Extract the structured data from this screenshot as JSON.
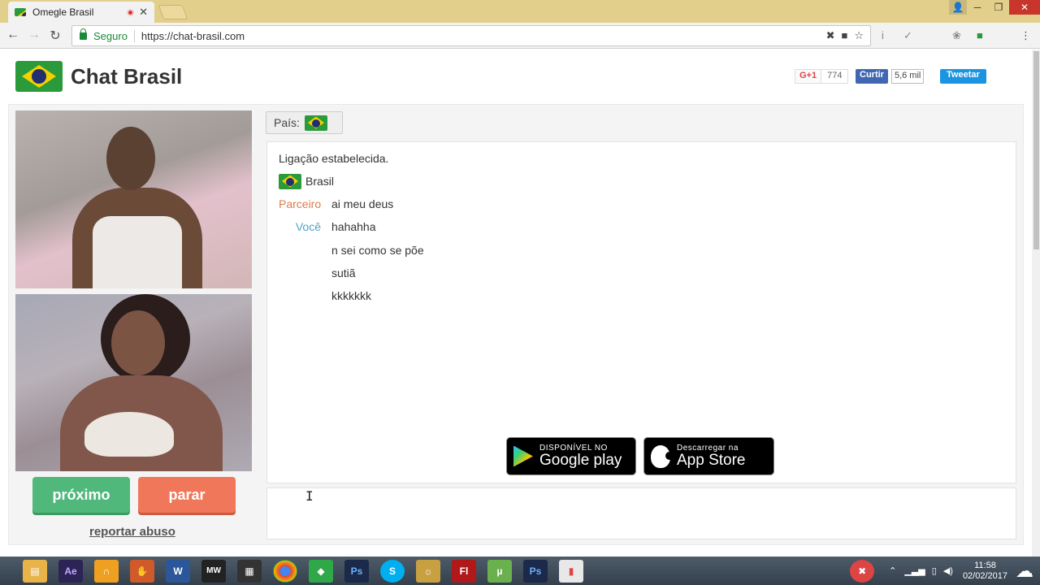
{
  "browser": {
    "tab_title": "Omegle Brasil",
    "tab_close": "✕",
    "secure_label": "Seguro",
    "url": "https://chat-brasil.com",
    "window_buttons": {
      "minimize": "─",
      "restore": "❐",
      "close": "✕"
    },
    "ext_info": "i",
    "ext_check": "✓"
  },
  "site": {
    "title": "Chat Brasil"
  },
  "social": {
    "gplus_label": "G+1",
    "gplus_count": "774",
    "fb_label": "Curtir",
    "fb_count": "5,6 mil",
    "tw_label": "Tweetar"
  },
  "controls": {
    "next_label": "próximo",
    "stop_label": "parar",
    "report_label": "reportar abuso",
    "country_label": "País:"
  },
  "chat": {
    "status": "Ligação estabelecida.",
    "country": "Brasil",
    "messages": [
      {
        "who": "Parceiro",
        "text": "ai meu deus"
      },
      {
        "who": "Você",
        "text": "hahahha"
      },
      {
        "who": "",
        "text": "n sei como se põe"
      },
      {
        "who": "",
        "text": "sutiã"
      },
      {
        "who": "",
        "text": "kkkkkkk"
      }
    ],
    "input_value": ""
  },
  "stores": {
    "google_small": "DISPONÍVEL NO",
    "google_big": "Google play",
    "apple_small": "Descarregar na",
    "apple_big": "App Store"
  },
  "taskbar": {
    "apps": [
      "Ae",
      "W",
      "MW",
      "Ps",
      "S",
      "Fl",
      "Ps"
    ],
    "time": "11:58",
    "date": "02/02/2017"
  },
  "colors": {
    "next_button": "#50b87a",
    "stop_button": "#f0775a",
    "partner_label": "#e07a4a",
    "you_label": "#4aa5c8",
    "titlebar": "#e3cf8c"
  }
}
